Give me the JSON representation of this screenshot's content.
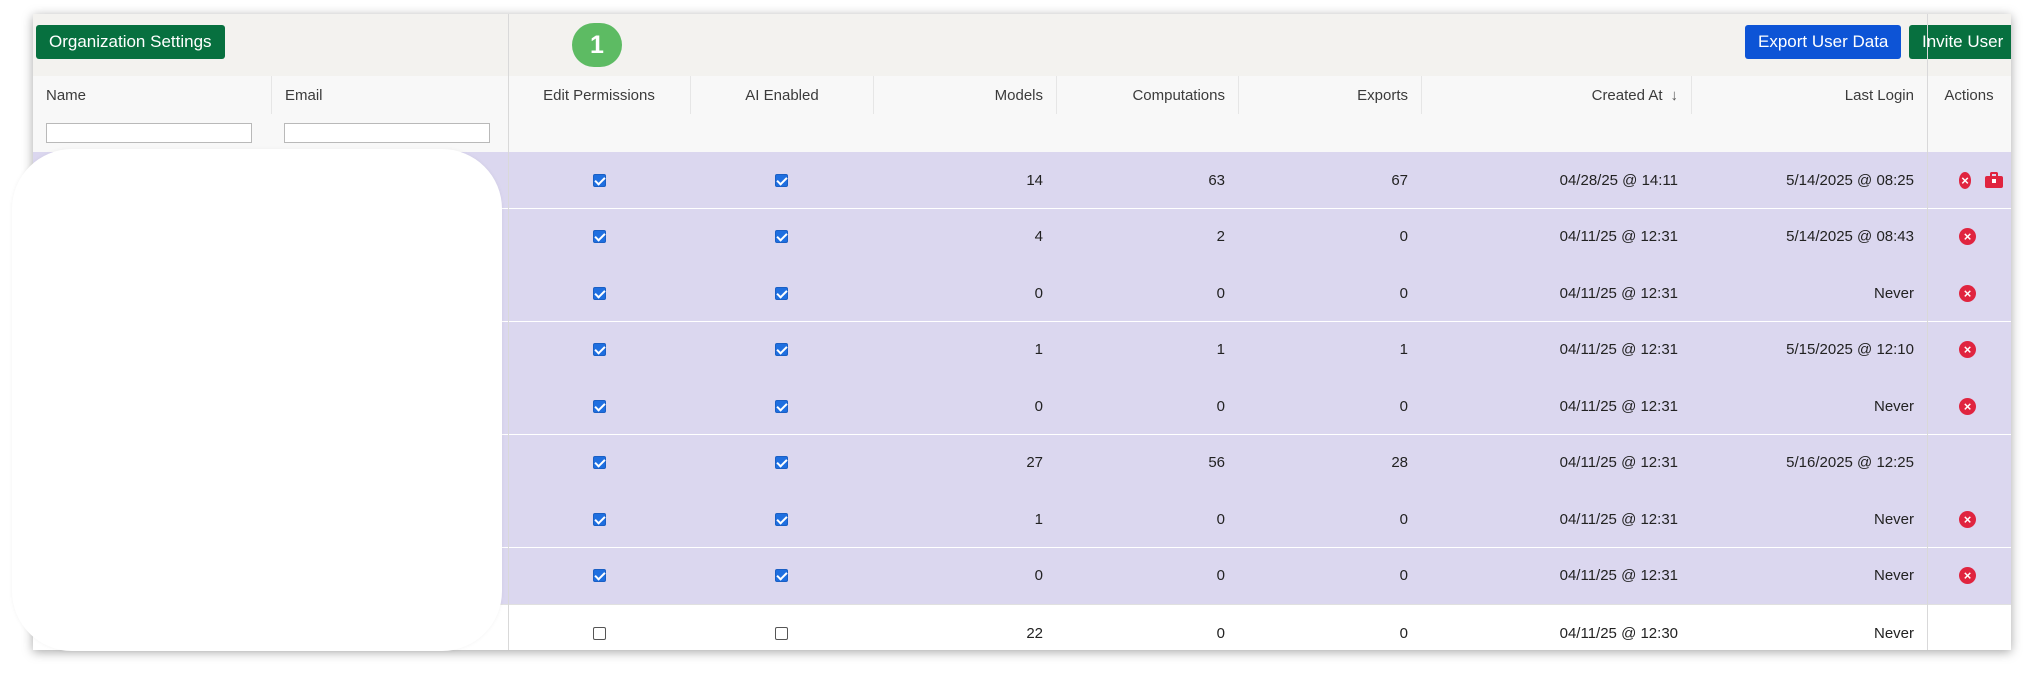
{
  "toolbar": {
    "org_settings_label": "Organization Settings",
    "step_number": "1",
    "export_label": "Export User Data",
    "invite_label": "Invite User"
  },
  "table": {
    "columns": {
      "name": "Name",
      "email": "Email",
      "edit_permissions": "Edit Permissions",
      "ai_enabled": "AI Enabled",
      "models": "Models",
      "computations": "Computations",
      "exports": "Exports",
      "created_at": "Created At",
      "last_login": "Last Login",
      "actions": "Actions"
    },
    "sort_indicator": "↓",
    "filters": {
      "name_value": "",
      "email_value": ""
    },
    "rows": [
      {
        "edit": true,
        "ai": true,
        "models": "14",
        "computations": "63",
        "exports": "67",
        "created": "04/28/25 @ 14:11",
        "last_login": "5/14/2025 @ 08:25",
        "delete": true,
        "briefcase": true,
        "selected": true
      },
      {
        "edit": true,
        "ai": true,
        "models": "4",
        "computations": "2",
        "exports": "0",
        "created": "04/11/25 @ 12:31",
        "last_login": "5/14/2025 @ 08:43",
        "delete": true,
        "briefcase": false,
        "selected": true
      },
      {
        "edit": true,
        "ai": true,
        "models": "0",
        "computations": "0",
        "exports": "0",
        "created": "04/11/25 @ 12:31",
        "last_login": "Never",
        "delete": true,
        "briefcase": false,
        "selected": true
      },
      {
        "edit": true,
        "ai": true,
        "models": "1",
        "computations": "1",
        "exports": "1",
        "created": "04/11/25 @ 12:31",
        "last_login": "5/15/2025 @ 12:10",
        "delete": true,
        "briefcase": false,
        "selected": true
      },
      {
        "edit": true,
        "ai": true,
        "models": "0",
        "computations": "0",
        "exports": "0",
        "created": "04/11/25 @ 12:31",
        "last_login": "Never",
        "delete": true,
        "briefcase": false,
        "selected": true
      },
      {
        "edit": true,
        "ai": true,
        "models": "27",
        "computations": "56",
        "exports": "28",
        "created": "04/11/25 @ 12:31",
        "last_login": "5/16/2025 @ 12:25",
        "delete": false,
        "briefcase": false,
        "selected": true
      },
      {
        "edit": true,
        "ai": true,
        "models": "1",
        "computations": "0",
        "exports": "0",
        "created": "04/11/25 @ 12:31",
        "last_login": "Never",
        "delete": true,
        "briefcase": false,
        "selected": true
      },
      {
        "edit": true,
        "ai": true,
        "models": "0",
        "computations": "0",
        "exports": "0",
        "created": "04/11/25 @ 12:31",
        "last_login": "Never",
        "delete": true,
        "briefcase": false,
        "selected": true
      },
      {
        "edit": false,
        "ai": false,
        "models": "22",
        "computations": "0",
        "exports": "0",
        "created": "04/11/25 @ 12:30",
        "last_login": "Never",
        "delete": false,
        "briefcase": false,
        "selected": false
      }
    ]
  },
  "colors": {
    "primary_green": "#07703f",
    "primary_blue": "#0d54d6",
    "selected_row": "#dbd7ef",
    "danger": "#e0243f",
    "badge": "#5dbb63"
  },
  "icons": {
    "delete": "close-circle-icon",
    "briefcase": "briefcase-icon",
    "sort": "arrow-down-icon"
  }
}
